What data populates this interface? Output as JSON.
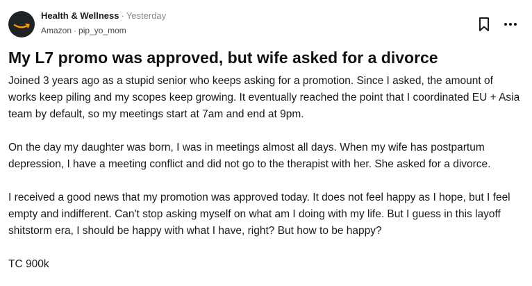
{
  "post": {
    "channel": "Health & Wellness",
    "separator": "·",
    "time": "Yesterday",
    "company": "Amazon",
    "author": "pip_yo_mom",
    "title": "My L7 promo was approved, but wife asked for a divorce",
    "paragraphs": [
      "Joined 3 years ago as a stupid senior who keeps asking for a promotion. Since I asked, the amount of works keep piling and my scopes keep growing. It eventually reached the point that I coordinated EU + Asia team by default, so my meetings start at 7am and end at 9pm.",
      "On the day my daughter was born, I was in meetings almost all days. When my wife has postpartum depression, I have a meeting conflict and did not go to the therapist with her. She asked for a divorce.",
      "I received a good news that my promotion was approved today. It does not feel happy as I hope, but I feel empty and indifferent. Can't stop asking myself on what am I doing with my life. But I guess in this layoff shitstorm era, I should be happy with what I have, right? But how to be happy?",
      "TC 900k"
    ]
  },
  "icons": {
    "avatar": "amazon-logo",
    "bookmark": "bookmark-icon",
    "more": "more-options-icon"
  },
  "colors": {
    "avatar_bg": "#1f2326",
    "smile": "#ff9900",
    "muted_text": "#8a8a8a"
  }
}
